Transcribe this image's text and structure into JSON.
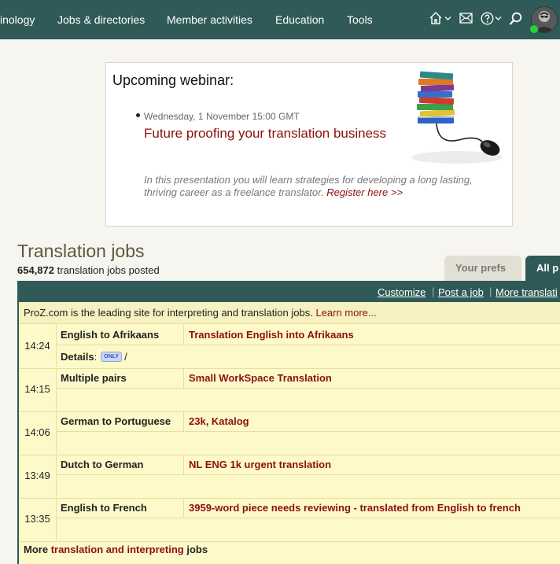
{
  "nav": {
    "items": [
      "inology",
      "Jobs & directories",
      "Member activities",
      "Education",
      "Tools"
    ],
    "icons": [
      "home-icon",
      "chevron-down-icon",
      "mail-icon",
      "help-icon",
      "chevron-down-icon",
      "search-icon"
    ]
  },
  "webinar": {
    "heading": "Upcoming webinar:",
    "date": "Wednesday, 1 November 15:00 GMT",
    "title": "Future proofing your translation business",
    "description": "In this presentation you will learn strategies for developing a long lasting, thriving career as a freelance translator.",
    "register": "Register here >>"
  },
  "jobs": {
    "title": "Translation jobs",
    "count": "654,872",
    "count_suffix": "translation jobs posted",
    "tabs": [
      "Your prefs",
      "All p"
    ],
    "bar_links": [
      "Customize",
      "Post a job",
      "More translati"
    ],
    "intro": "ProZ.com is the leading site for interpreting and translation jobs.",
    "learn_more": "Learn more...",
    "rows": [
      {
        "time": "14:24",
        "pair": "English to Afrikaans",
        "title": "Translation English into Afrikaans",
        "details_label": "Details",
        "details_badge": "ONLY",
        "details_tail": "/"
      },
      {
        "time": "14:15",
        "pair": "Multiple pairs",
        "title": "Small WorkSpace Translation"
      },
      {
        "time": "14:06",
        "pair": "German to Portuguese",
        "title": "23k, Katalog"
      },
      {
        "time": "13:49",
        "pair": "Dutch to German",
        "title": "NL ENG 1k urgent translation"
      },
      {
        "time": "13:35",
        "pair": "English to French",
        "title": "3959-word piece needs reviewing - translated from English to french"
      }
    ],
    "more_prefix": "More",
    "more_link": "translation and interpreting",
    "more_suffix": "jobs"
  }
}
